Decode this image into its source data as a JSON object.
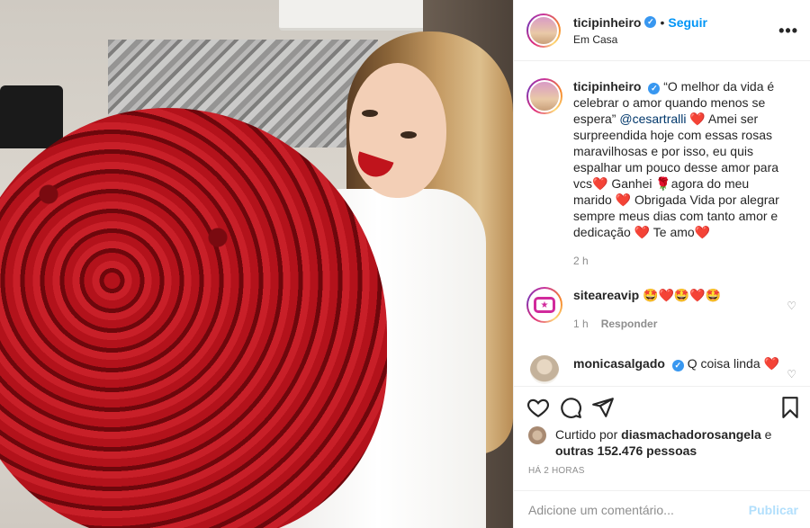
{
  "photo": {
    "description_icon": "photo-roses-woman"
  },
  "header": {
    "username": "ticipinheiro",
    "verified_icon": "verified-badge-icon",
    "separator": "•",
    "follow_label": "Seguir",
    "location": "Em Casa",
    "more_label": "•••"
  },
  "caption": {
    "username": "ticipinheiro",
    "text_before": "“O melhor da vida é celebrar o amor quando menos se espera” ",
    "mention": "@cesartralli",
    "text_after": " ❤️ Amei ser surpreendida hoje com essas rosas maravilhosas e por isso, eu quis espalhar um pouco desse amor para vcs❤️ Ganhei 🌹agora do meu marido ❤️ Obrigada Vida por alegrar sempre meus dias com tanto amor e dedicação ❤️ Te amo❤️",
    "time": "2 h"
  },
  "comments": [
    {
      "username": "siteareavip",
      "text": "🤩❤️🤩❤️🤩",
      "time": "1 h",
      "reply_label": "Responder"
    },
    {
      "username": "monicasalgado",
      "text": "Q coisa linda ❤️"
    }
  ],
  "likes": {
    "prefix": "Curtido por ",
    "user": "diasmachadorosangela",
    "middle": " e ",
    "others": "outras 152.476 pessoas"
  },
  "timestamp": "HÁ 2 HORAS",
  "add_comment": {
    "placeholder": "Adicione um comentário...",
    "post_label": "Publicar"
  },
  "colors": {
    "accent": "#0095f6",
    "verified": "#3897f0",
    "muted": "#8e8e8e"
  }
}
